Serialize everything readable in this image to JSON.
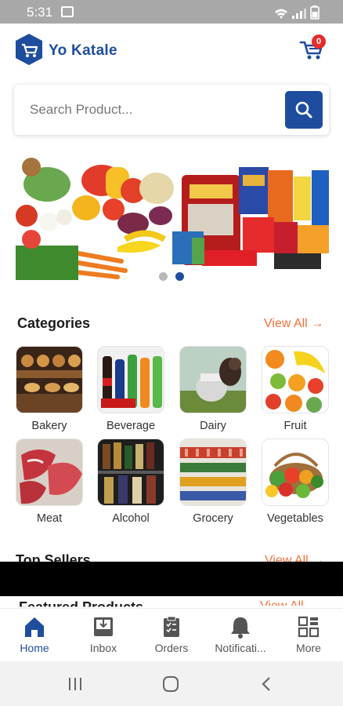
{
  "status_bar": {
    "time": "5:31"
  },
  "header": {
    "brand": "Yo Katale",
    "cart_count": "0"
  },
  "search": {
    "placeholder": "Search Product..."
  },
  "banner": {
    "slides": 2,
    "active_slide": 2
  },
  "categories": {
    "title": "Categories",
    "view_all": "View All",
    "items": [
      {
        "label": "Bakery"
      },
      {
        "label": "Beverage"
      },
      {
        "label": "Dairy"
      },
      {
        "label": "Fruit"
      },
      {
        "label": "Meat"
      },
      {
        "label": "Alcohol"
      },
      {
        "label": "Grocery"
      },
      {
        "label": "Vegetables"
      }
    ]
  },
  "top_sellers": {
    "title": "Top Sellers",
    "view_all": "View All"
  },
  "featured": {
    "title": "Featured Products",
    "view_all": "View All"
  },
  "bottom_nav": {
    "active": "Home",
    "items": [
      {
        "label": "Home",
        "icon": "home-icon"
      },
      {
        "label": "Inbox",
        "icon": "inbox-icon"
      },
      {
        "label": "Orders",
        "icon": "clipboard-icon"
      },
      {
        "label": "Notificati...",
        "icon": "bell-icon"
      },
      {
        "label": "More",
        "icon": "grid-icon"
      }
    ]
  },
  "colors": {
    "brand": "#1f4d9e",
    "accent": "#f2713a",
    "badge": "#e52b2b"
  }
}
